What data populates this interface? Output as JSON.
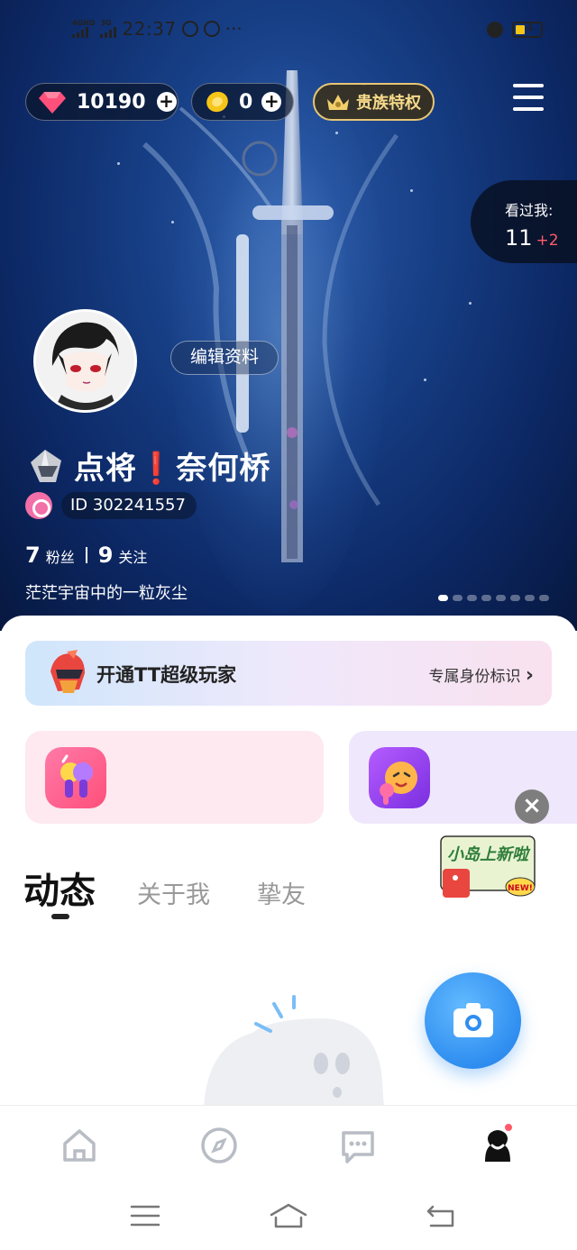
{
  "status_bar": {
    "signal1_label": "4GHD",
    "signal2_label": "3G",
    "time": "22:37",
    "dots": "···",
    "battery_level": "4"
  },
  "top_bar": {
    "diamonds": "10190",
    "coins": "0",
    "noble_label": "贵族特权"
  },
  "visitors": {
    "label": "看过我:",
    "count": "11",
    "increase": "+2"
  },
  "profile": {
    "edit_label": "编辑资料",
    "name": "点将❗奈何桥",
    "id_text": "ID  302241557",
    "fans_count": "7",
    "fans_label": "粉丝",
    "following_count": "9",
    "following_label": "关注",
    "bio": "茫茫宇宙中的一粒灰尘",
    "carousel_total": 8,
    "carousel_active": 0
  },
  "vip_banner": {
    "title": "开通TT超级玩家",
    "subtitle": "专属身份标识",
    "arrow": "›"
  },
  "tabs": {
    "items": [
      "动态",
      "关于我",
      "挚友"
    ],
    "active": 0
  },
  "promo": {
    "badge": "NEW!",
    "text": "小岛上新啦"
  },
  "close_glyph": "×",
  "colors": {
    "accent_blue": "#2f8ef0",
    "visitor_increase": "#ff5a6a",
    "noble_gold": "#e7c675",
    "diamond": "#ff4f7b",
    "coin": "#f5c518"
  },
  "nav": {
    "items": [
      "home-icon",
      "discover-compass-icon",
      "messages-icon",
      "profile-icon"
    ],
    "active": 3
  }
}
